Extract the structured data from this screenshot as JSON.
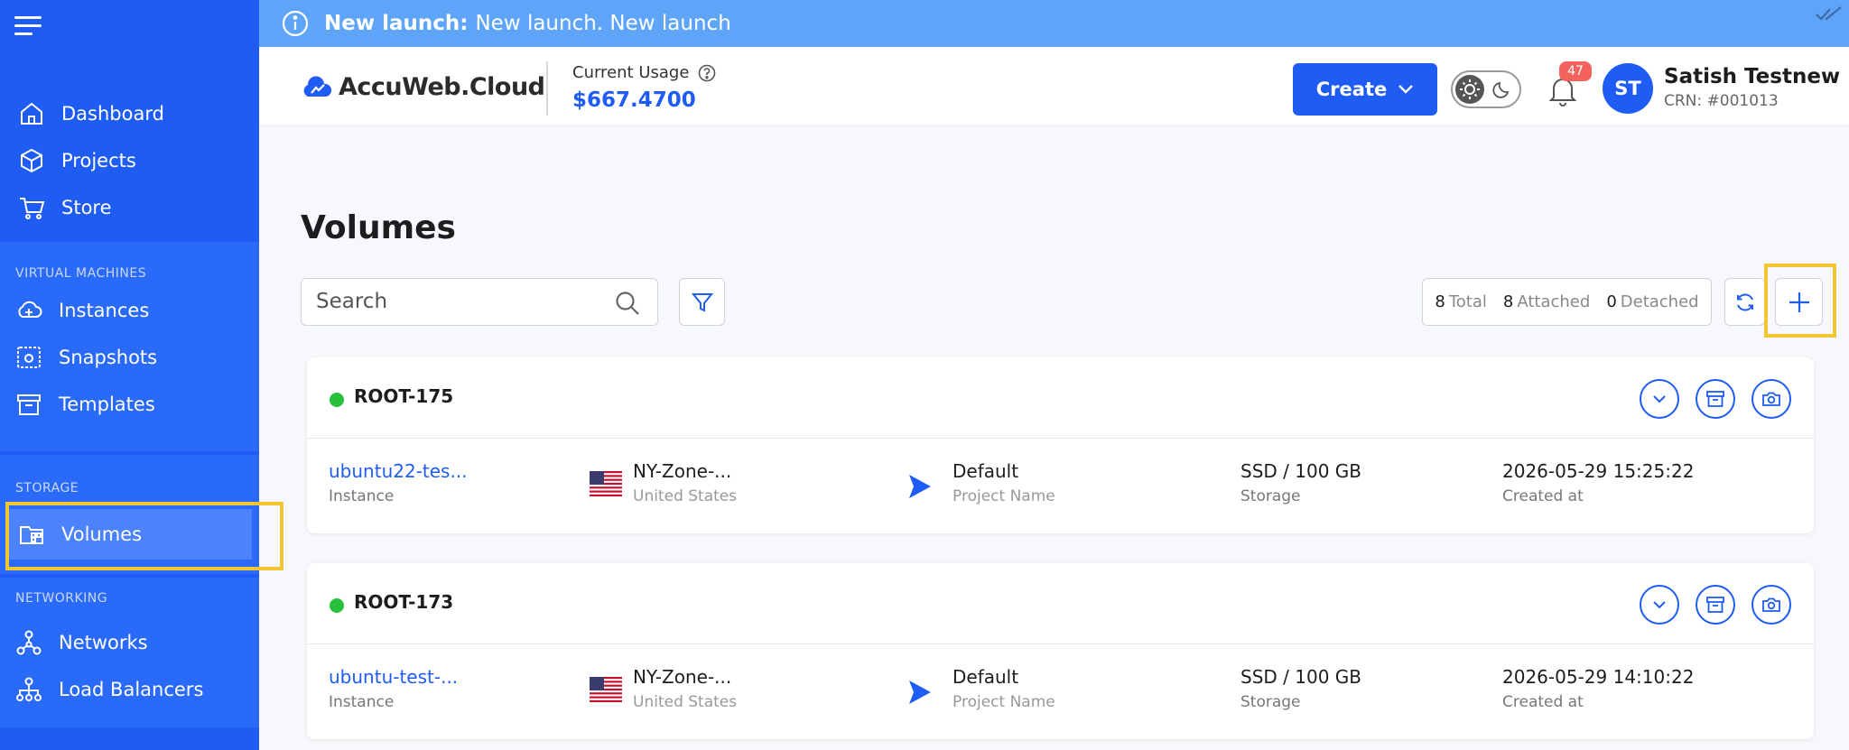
{
  "announcement": {
    "bold": "New launch:",
    "text": "New launch. New launch"
  },
  "sidebar": {
    "top_items": [
      {
        "label": "Dashboard",
        "icon": "home-icon"
      },
      {
        "label": "Projects",
        "icon": "cube-icon"
      },
      {
        "label": "Store",
        "icon": "cart-icon"
      }
    ],
    "sections": [
      {
        "title": "VIRTUAL MACHINES",
        "items": [
          {
            "label": "Instances",
            "icon": "cloud-plus-icon"
          },
          {
            "label": "Snapshots",
            "icon": "camera-icon"
          },
          {
            "label": "Templates",
            "icon": "archive-icon"
          }
        ]
      },
      {
        "title": "STORAGE",
        "items": [
          {
            "label": "Volumes",
            "icon": "folder-grid-icon",
            "active": true
          }
        ]
      },
      {
        "title": "NETWORKING",
        "items": [
          {
            "label": "Networks",
            "icon": "network-icon"
          },
          {
            "label": "Load Balancers",
            "icon": "sitemap-icon"
          }
        ]
      }
    ]
  },
  "header": {
    "logo_text": "AccuWeb.Cloud",
    "usage_label": "Current Usage",
    "usage_value": "$667.4700",
    "create_label": "Create",
    "notification_count": "47",
    "avatar_initials": "ST",
    "user_name": "Satish Testnew",
    "user_crn": "CRN: #001013"
  },
  "main": {
    "title": "Volumes",
    "search_placeholder": "Search",
    "stats": {
      "total": "8",
      "total_label": "Total",
      "attached": "8",
      "attached_label": "Attached",
      "detached": "0",
      "detached_label": "Detached"
    },
    "volumes": [
      {
        "name": "ROOT-175",
        "instance": "ubuntu22-tes...",
        "instance_label": "Instance",
        "zone": "NY-Zone-...",
        "country": "United States",
        "project": "Default",
        "project_label": "Project Name",
        "storage": "SSD / 100 GB",
        "storage_label": "Storage",
        "created": "2026-05-29 15:25:22",
        "created_label": "Created at"
      },
      {
        "name": "ROOT-173",
        "instance": "ubuntu-test-...",
        "instance_label": "Instance",
        "zone": "NY-Zone-...",
        "country": "United States",
        "project": "Default",
        "project_label": "Project Name",
        "storage": "SSD / 100 GB",
        "storage_label": "Storage",
        "created": "2026-05-29 14:10:22",
        "created_label": "Created at"
      }
    ]
  },
  "colors": {
    "brand": "#1f5cf3",
    "announce": "#5ea5fa",
    "highlight": "#f2c534",
    "status_ok": "#26c03a"
  }
}
